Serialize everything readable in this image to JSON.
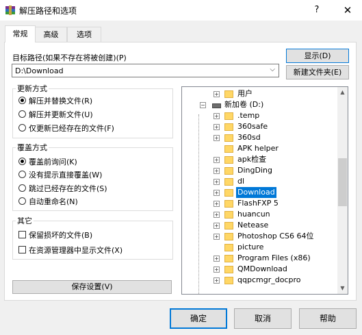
{
  "window": {
    "title": "解压路径和选项",
    "help_glyph": "?",
    "close_glyph": "✕"
  },
  "tabs": [
    {
      "label": "常规",
      "active": true
    },
    {
      "label": "高级",
      "active": false
    },
    {
      "label": "选项",
      "active": false
    }
  ],
  "path": {
    "label": "目标路径(如果不存在将被创建)(P)",
    "value": "D:\\Download",
    "dropdown_glyph": "⌵",
    "show_button": "显示(D)",
    "new_folder_button": "新建文件夹(E)"
  },
  "update_mode": {
    "title": "更新方式",
    "options": [
      {
        "label": "解压并替换文件(R)",
        "checked": true
      },
      {
        "label": "解压并更新文件(U)",
        "checked": false
      },
      {
        "label": "仅更新已经存在的文件(F)",
        "checked": false
      }
    ]
  },
  "overwrite_mode": {
    "title": "覆盖方式",
    "options": [
      {
        "label": "覆盖前询问(K)",
        "checked": true
      },
      {
        "label": "没有提示直接覆盖(W)",
        "checked": false
      },
      {
        "label": "跳过已经存在的文件(S)",
        "checked": false
      },
      {
        "label": "自动重命名(N)",
        "checked": false
      }
    ]
  },
  "misc": {
    "title": "其它",
    "options": [
      {
        "label": "保留损坏的文件(B)",
        "checked": false
      },
      {
        "label": "在资源管理器中显示文件(X)",
        "checked": false
      }
    ]
  },
  "save_button": "保存设置(V)",
  "tree": {
    "expand_glyph": "+",
    "collapse_glyph": "−",
    "scroll_up_glyph": "▲",
    "scroll_down_glyph": "▼",
    "items": [
      {
        "label": "用户",
        "kind": "folder",
        "level": 1,
        "expander": "plus"
      },
      {
        "label": "新加卷 (D:)",
        "kind": "drive",
        "level": 0,
        "expander": "minus"
      },
      {
        "label": ".temp",
        "kind": "folder",
        "level": 1,
        "expander": "plus"
      },
      {
        "label": "360safe",
        "kind": "folder",
        "level": 1,
        "expander": "plus"
      },
      {
        "label": "360sd",
        "kind": "folder",
        "level": 1,
        "expander": "plus"
      },
      {
        "label": "APK helper",
        "kind": "folder",
        "level": 1,
        "expander": "none"
      },
      {
        "label": "apk检查",
        "kind": "folder",
        "level": 1,
        "expander": "plus"
      },
      {
        "label": "DingDing",
        "kind": "folder",
        "level": 1,
        "expander": "plus"
      },
      {
        "label": "dl",
        "kind": "folder",
        "level": 1,
        "expander": "plus"
      },
      {
        "label": "Download",
        "kind": "folder",
        "level": 1,
        "expander": "plus",
        "selected": true
      },
      {
        "label": "FlashFXP 5",
        "kind": "folder",
        "level": 1,
        "expander": "plus"
      },
      {
        "label": "huancun",
        "kind": "folder",
        "level": 1,
        "expander": "plus"
      },
      {
        "label": "Netease",
        "kind": "folder",
        "level": 1,
        "expander": "plus"
      },
      {
        "label": "Photoshop CS6 64位",
        "kind": "folder",
        "level": 1,
        "expander": "plus"
      },
      {
        "label": "picture",
        "kind": "folder",
        "level": 1,
        "expander": "none"
      },
      {
        "label": "Program Files (x86)",
        "kind": "folder",
        "level": 1,
        "expander": "plus"
      },
      {
        "label": "QMDownload",
        "kind": "folder",
        "level": 1,
        "expander": "plus"
      },
      {
        "label": "qqpcmgr_docpro",
        "kind": "folder",
        "level": 1,
        "expander": "plus"
      }
    ]
  },
  "buttons": {
    "ok": "确定",
    "cancel": "取消",
    "help": "帮助"
  },
  "colors": {
    "accent": "#0078d7",
    "folder": "#ffd766"
  }
}
